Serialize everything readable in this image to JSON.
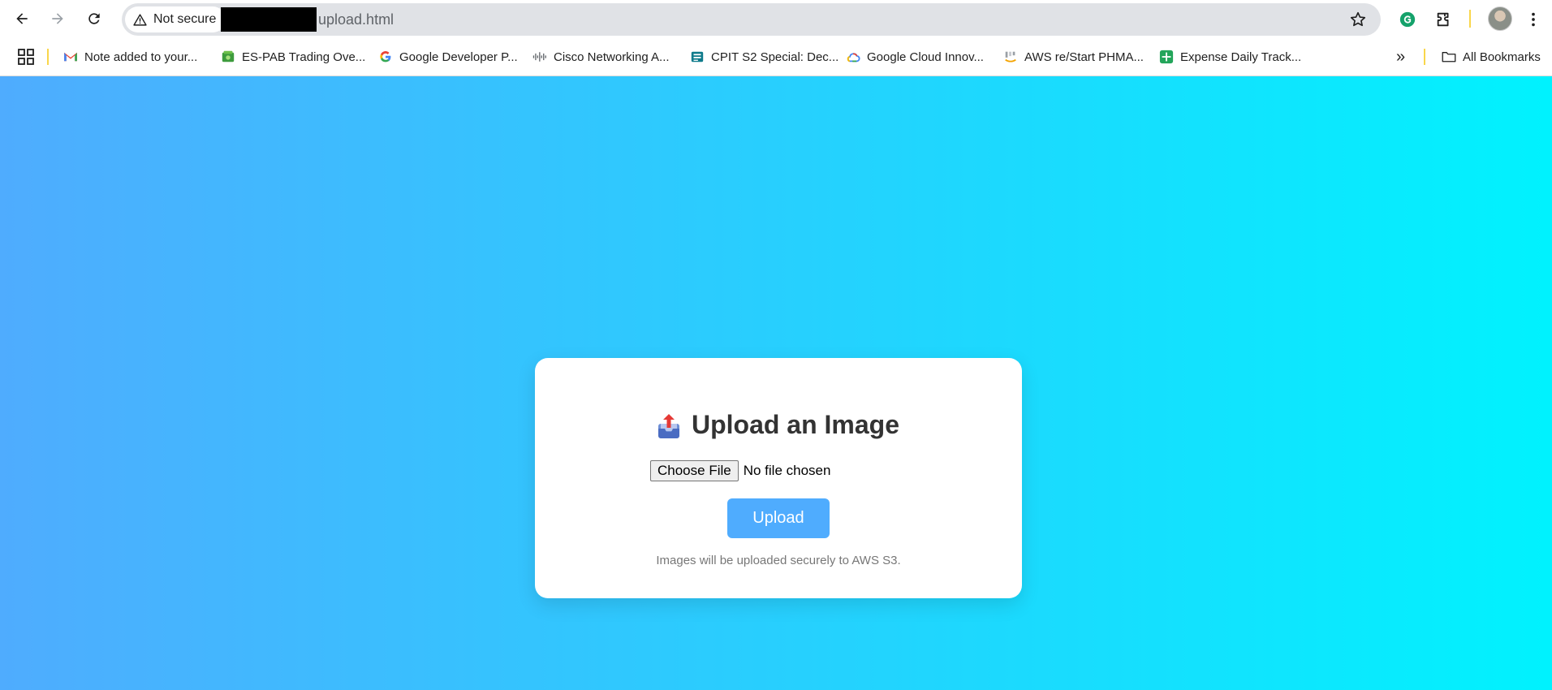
{
  "browser": {
    "security_chip": "Not secure",
    "url_path": "upload.html",
    "icons": [
      "back-icon",
      "forward-icon",
      "reload-icon",
      "warning-icon",
      "star-icon",
      "grammarly-icon",
      "extensions-icon",
      "menu-icon"
    ]
  },
  "bookmarks": {
    "items": [
      {
        "label": "Note added to your...",
        "icon": "gmail-icon"
      },
      {
        "label": "ES-PAB Trading Ove...",
        "icon": "money-icon"
      },
      {
        "label": "Google Developer P...",
        "icon": "google-icon"
      },
      {
        "label": "Cisco Networking A...",
        "icon": "cisco-icon"
      },
      {
        "label": "CPIT S2 Special: Dec...",
        "icon": "sheet-icon"
      },
      {
        "label": "Google Cloud Innov...",
        "icon": "cloud-icon"
      },
      {
        "label": "AWS re/Start PHMA...",
        "icon": "aws-icon"
      },
      {
        "label": "Expense Daily Track...",
        "icon": "sheets-plus-icon"
      }
    ],
    "overflow": "»",
    "all_bookmarks": "All Bookmarks"
  },
  "card": {
    "title": "Upload an Image",
    "choose_file_label": "Choose File",
    "file_status": "No file chosen",
    "upload_label": "Upload",
    "note": "Images will be uploaded securely to AWS S3."
  },
  "colors": {
    "gradient_start": "#4facfe",
    "gradient_end": "#00f2fe",
    "button": "#4facfe",
    "title": "#333333"
  }
}
